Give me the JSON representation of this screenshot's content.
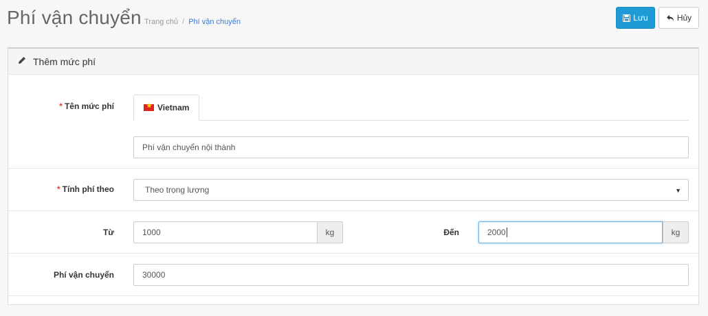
{
  "header": {
    "title": "Phí vận chuyển",
    "breadcrumb": {
      "home": "Trang chủ",
      "separator": "/",
      "current": "Phí vận chuyển"
    },
    "save_label": "Lưu",
    "cancel_label": "Hủy"
  },
  "panel": {
    "title": "Thêm mức phí",
    "fields": {
      "name": {
        "required_mark": "*",
        "label": "Tên mức phí",
        "tab_label": "Vietnam",
        "value": "Phí vận chuyển nội thành"
      },
      "calc_by": {
        "required_mark": "*",
        "label": "Tính phí theo",
        "selected": "Theo trọng lượng"
      },
      "from": {
        "label": "Từ",
        "value": "1000",
        "unit": "kg"
      },
      "to": {
        "label": "Đến",
        "value": "2000",
        "unit": "kg"
      },
      "fee": {
        "label": "Phí vận chuyển",
        "value": "30000"
      }
    }
  },
  "colors": {
    "primary": "#1e9ad6",
    "required": "#e53935",
    "link": "#3a7bd5"
  }
}
